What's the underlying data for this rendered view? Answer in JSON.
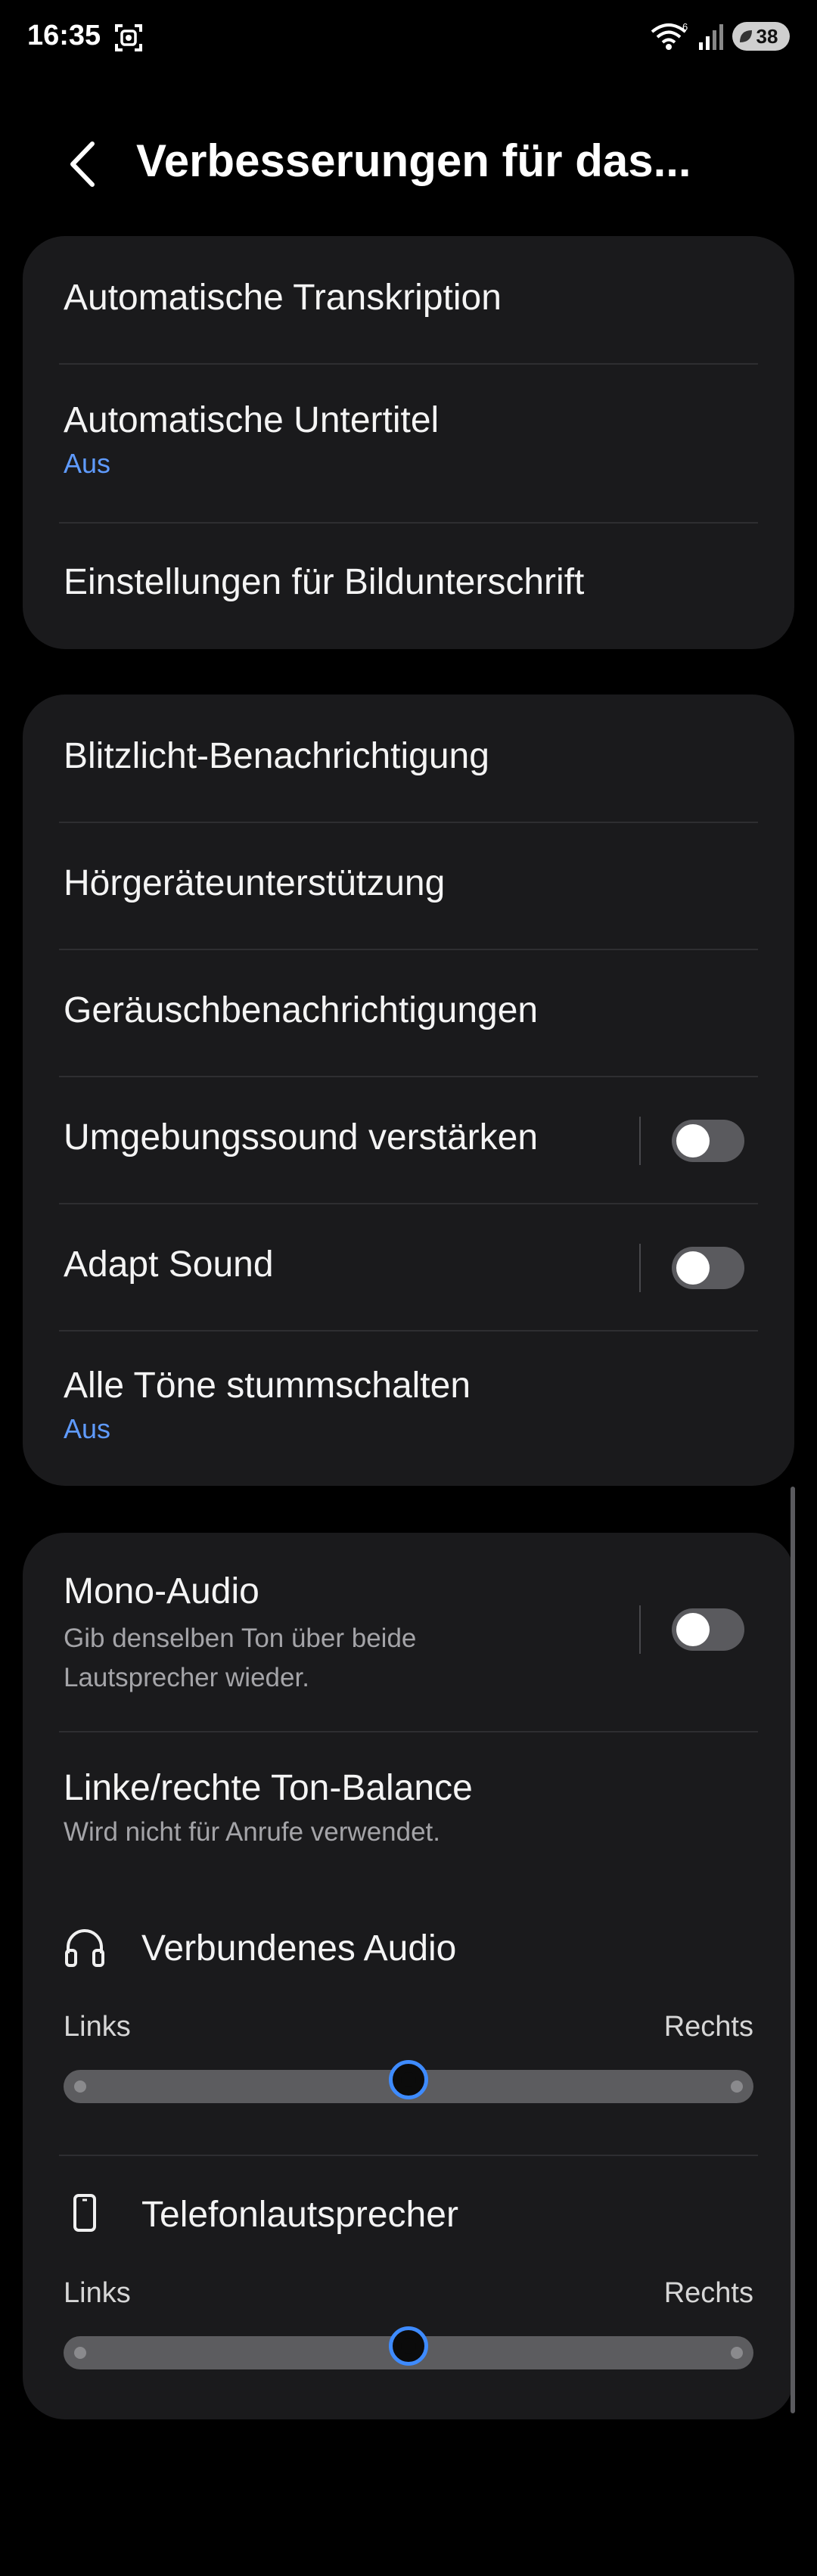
{
  "status_bar": {
    "time": "16:35",
    "battery": "38",
    "wifi_label": "6"
  },
  "header": {
    "title": "Verbesserungen für das..."
  },
  "group1": {
    "items": [
      {
        "label": "Automatische Transkription"
      },
      {
        "label": "Automatische Untertitel",
        "status": "Aus"
      },
      {
        "label": "Einstellungen für Bildunterschrift"
      }
    ]
  },
  "group2": {
    "items": [
      {
        "label": "Blitzlicht-Benachrichtigung"
      },
      {
        "label": "Hörgeräteunterstützung"
      },
      {
        "label": "Geräuschbenachrichtigungen"
      },
      {
        "label": "Umgebungssound verstärken",
        "toggle": false
      },
      {
        "label": "Adapt Sound",
        "toggle": false
      },
      {
        "label": "Alle Töne stummschalten",
        "status": "Aus"
      }
    ]
  },
  "group3": {
    "mono_audio": {
      "label": "Mono-Audio",
      "description": "Gib denselben Ton über beide Lautsprecher wieder.",
      "toggle": false
    },
    "balance": {
      "label": "Linke/rechte Ton-Balance",
      "description": "Wird nicht für Anrufe verwendet.",
      "connected_audio": {
        "label": "Verbundenes Audio",
        "left": "Links",
        "right": "Rechts",
        "value": 0.5
      },
      "phone_speaker": {
        "label": "Telefonlautsprecher",
        "left": "Links",
        "right": "Rechts",
        "value": 0.5
      }
    }
  },
  "icons": [
    "screen-record-icon",
    "wifi-icon",
    "signal-icon",
    "battery-icon",
    "back-icon",
    "headphones-icon",
    "phone-icon"
  ],
  "colors": {
    "background": "#000000",
    "card": "#1a1a1c",
    "accent": "#5f9bff",
    "slider_thumb_border": "#3e8bff"
  }
}
